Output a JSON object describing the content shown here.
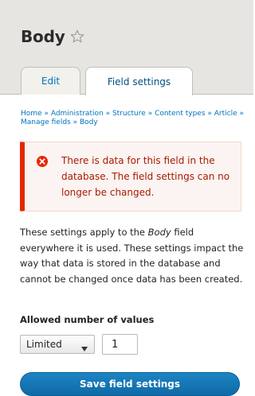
{
  "header": {
    "title": "Body",
    "star_icon": "star-outline-icon",
    "tabs": [
      {
        "label": "Edit",
        "active": false
      },
      {
        "label": "Field settings",
        "active": true
      }
    ]
  },
  "breadcrumb": {
    "items": [
      "Home",
      "Administration",
      "Structure",
      "Content types",
      "Article",
      "Manage fields",
      "Body"
    ],
    "separator": "»"
  },
  "alert": {
    "icon": "error-circle-icon",
    "text": "There is data for this field in the database. The field settings can no longer be changed."
  },
  "description": {
    "before": "These settings apply to the ",
    "field_name": "Body",
    "after": " field everywhere it is used. These settings impact the way that data is stored in the database and cannot be changed once data has been created."
  },
  "form": {
    "allowed_values_label": "Allowed number of values",
    "cardinality_select_value": "Limited",
    "cardinality_number_value": "1",
    "save_label": "Save field settings"
  },
  "colors": {
    "link": "#0074bd",
    "error": "#e62600",
    "error_text": "#a51b00",
    "primary_button": "#0f6aa7",
    "header_bg": "#e6e5e1"
  }
}
